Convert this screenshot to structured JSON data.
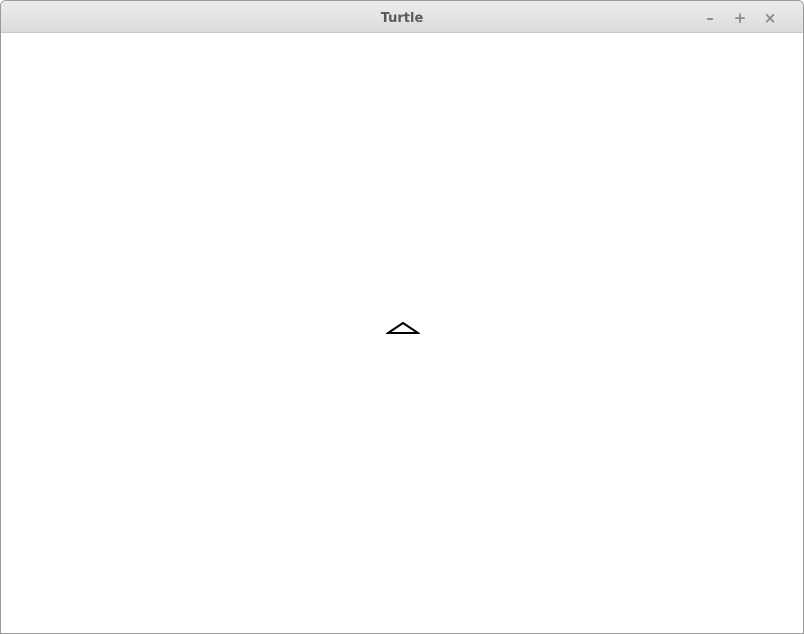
{
  "window": {
    "title": "Turtle",
    "controls": {
      "minimize_glyph": "–",
      "maximize_glyph": "+",
      "close_glyph": "×"
    }
  },
  "canvas": {
    "background": "#ffffff",
    "turtle": {
      "icon": "triangle-up-icon",
      "stroke": "#000000"
    }
  }
}
